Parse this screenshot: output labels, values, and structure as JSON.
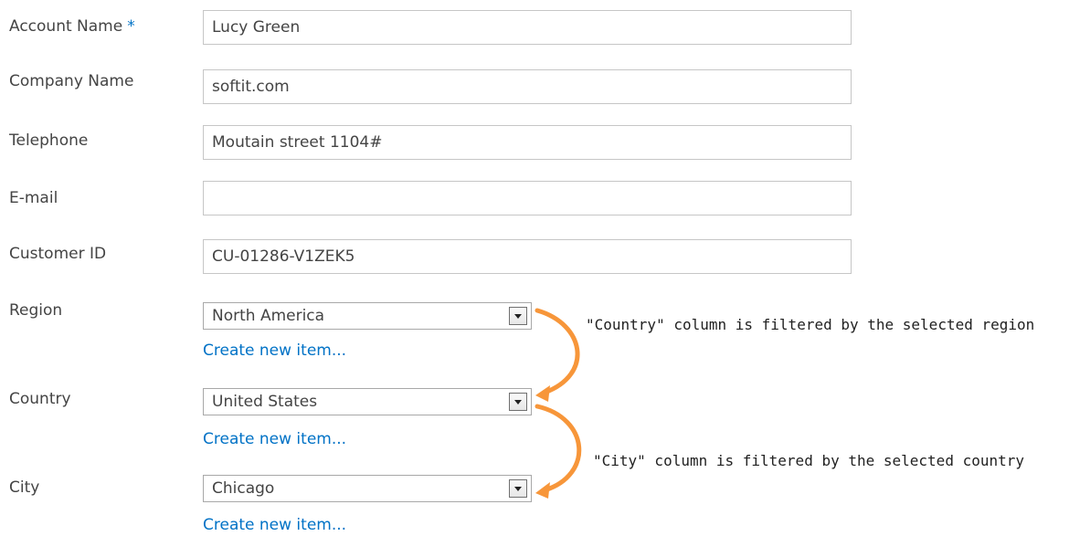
{
  "form": {
    "account_name": {
      "label": "Account Name",
      "required_marker": "*",
      "value": "Lucy Green"
    },
    "company_name": {
      "label": "Company Name",
      "value": "softit.com"
    },
    "telephone": {
      "label": "Telephone",
      "value": "Moutain street 1104#"
    },
    "email": {
      "label": "E-mail",
      "value": ""
    },
    "customer_id": {
      "label": "Customer ID",
      "value": "CU-01286-V1ZEK5"
    },
    "region": {
      "label": "Region",
      "selected": "North America",
      "create_link": "Create new item..."
    },
    "country": {
      "label": "Country",
      "selected": "United States",
      "create_link": "Create new item..."
    },
    "city": {
      "label": "City",
      "selected": "Chicago",
      "create_link": "Create new item..."
    }
  },
  "annotations": {
    "country_filter": "\"Country\" column is filtered by the selected region",
    "city_filter": "\"City\" column is filtered by the selected country"
  },
  "colors": {
    "link": "#0072c6",
    "required": "#0072c6",
    "arrow": "#f7963a"
  },
  "icons": {
    "dropdown": "chevron-down-icon"
  }
}
